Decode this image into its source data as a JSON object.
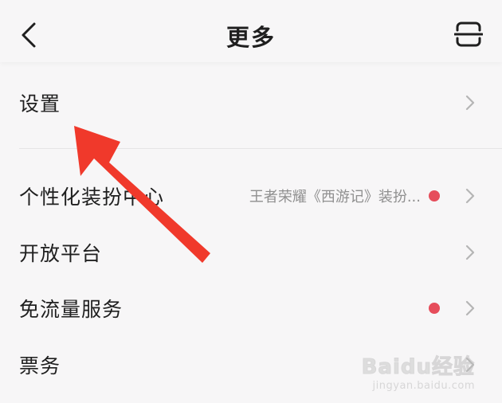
{
  "header": {
    "title": "更多",
    "back_icon": "chevron-left-icon",
    "scan_icon": "scan-icon"
  },
  "rows": [
    {
      "label": "设置",
      "sub": "",
      "dot": false
    },
    {
      "label": "个性化装扮中心",
      "sub": "王者荣耀《西游记》装扮...",
      "dot": true
    },
    {
      "label": "开放平台",
      "sub": "",
      "dot": false
    },
    {
      "label": "免流量服务",
      "sub": "",
      "dot": true
    },
    {
      "label": "票务",
      "sub": "",
      "dot": false
    }
  ],
  "colors": {
    "background": "#f7f6f7",
    "text": "#1f1f1f",
    "subtext": "#8f8f8f",
    "dot": "#e64d5b",
    "chevron": "#b5b5b5",
    "annotation_arrow": "#f0392b"
  },
  "watermark": {
    "logo": "Baidu经验",
    "url": "jingyan.baidu.com"
  }
}
